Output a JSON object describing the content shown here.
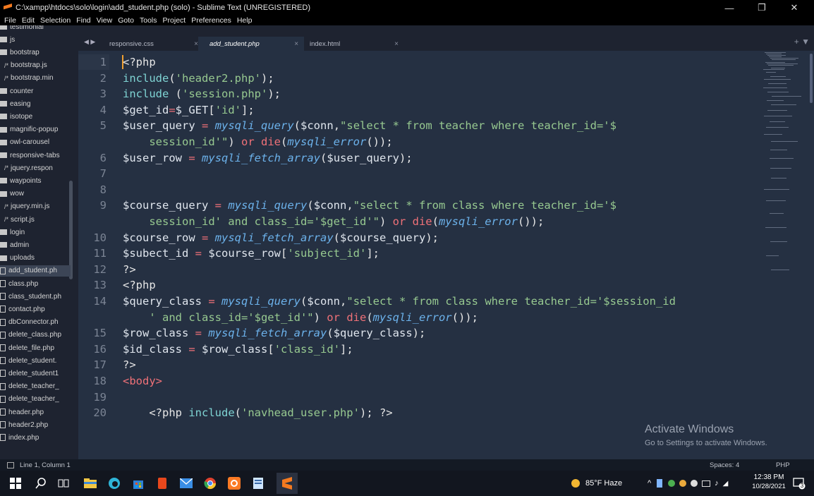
{
  "window": {
    "title": "C:\\xampp\\htdocs\\solo\\login\\add_student.php (solo) - Sublime Text (UNREGISTERED)",
    "minimize": "—",
    "maximize": "❐",
    "close": "✕"
  },
  "menu": [
    "File",
    "Edit",
    "Selection",
    "Find",
    "View",
    "Goto",
    "Tools",
    "Project",
    "Preferences",
    "Help"
  ],
  "sidebar": {
    "items": [
      {
        "label": "testimonial",
        "type": "folder"
      },
      {
        "label": "js",
        "type": "folder-open"
      },
      {
        "label": "bootstrap",
        "type": "folder-open"
      },
      {
        "label": "bootstrap.js",
        "type": "js"
      },
      {
        "label": "bootstrap.min",
        "type": "js"
      },
      {
        "label": "counter",
        "type": "folder"
      },
      {
        "label": "easing",
        "type": "folder"
      },
      {
        "label": "isotope",
        "type": "folder"
      },
      {
        "label": "magnific-popup",
        "type": "folder"
      },
      {
        "label": "owl-carousel",
        "type": "folder"
      },
      {
        "label": "responsive-tabs",
        "type": "folder"
      },
      {
        "label": "jquery.respon",
        "type": "js"
      },
      {
        "label": "waypoints",
        "type": "folder"
      },
      {
        "label": "wow",
        "type": "folder"
      },
      {
        "label": "jquery.min.js",
        "type": "js"
      },
      {
        "label": "script.js",
        "type": "js"
      },
      {
        "label": "login",
        "type": "folder-open"
      },
      {
        "label": "admin",
        "type": "folder"
      },
      {
        "label": "uploads",
        "type": "folder"
      },
      {
        "label": "add_student.ph",
        "type": "file",
        "active": true
      },
      {
        "label": "class.php",
        "type": "file"
      },
      {
        "label": "class_student.ph",
        "type": "file"
      },
      {
        "label": "contact.php",
        "type": "file"
      },
      {
        "label": "dbConnector.ph",
        "type": "file"
      },
      {
        "label": "delete_class.php",
        "type": "file"
      },
      {
        "label": "delete_file.php",
        "type": "file"
      },
      {
        "label": "delete_student.",
        "type": "file"
      },
      {
        "label": "delete_student1",
        "type": "file"
      },
      {
        "label": "delete_teacher_",
        "type": "file"
      },
      {
        "label": "delete_teacher_",
        "type": "file"
      },
      {
        "label": "header.php",
        "type": "file"
      },
      {
        "label": "header2.php",
        "type": "file"
      },
      {
        "label": "index.php",
        "type": "file"
      }
    ]
  },
  "tabs": [
    {
      "label": "responsive.css",
      "close": "×"
    },
    {
      "label": "add_student.php",
      "close": "×",
      "active": true
    },
    {
      "label": "index.html",
      "close": "×"
    }
  ],
  "tab_controls": {
    "arrows": "◀ ▶",
    "plus": "+ ▼"
  },
  "editor": {
    "line_numbers": [
      "1",
      "2",
      "3",
      "4",
      "5",
      "",
      "6",
      "7",
      "8",
      "9",
      "",
      "10",
      "11",
      "12",
      "13",
      "14",
      "",
      "15",
      "16",
      "17",
      "18",
      "19",
      "20"
    ],
    "lines": [
      [
        [
          "plain",
          "<?php"
        ]
      ],
      [
        [
          "kw",
          "include"
        ],
        [
          "plain",
          "("
        ],
        [
          "str",
          "'header2.php'"
        ],
        [
          "plain",
          ");"
        ]
      ],
      [
        [
          "kw",
          "include"
        ],
        [
          "plain",
          " ("
        ],
        [
          "str",
          "'session.php'"
        ],
        [
          "plain",
          ");"
        ]
      ],
      [
        [
          "var",
          "$get_id"
        ],
        [
          "op",
          "="
        ],
        [
          "var",
          "$_GET"
        ],
        [
          "plain",
          "["
        ],
        [
          "str",
          "'id'"
        ],
        [
          "plain",
          "];"
        ]
      ],
      [
        [
          "var",
          "$user_query"
        ],
        [
          "plain",
          " "
        ],
        [
          "op",
          "="
        ],
        [
          "plain",
          " "
        ],
        [
          "fn",
          "mysqli_query"
        ],
        [
          "plain",
          "("
        ],
        [
          "var",
          "$conn"
        ],
        [
          "plain",
          ","
        ],
        [
          "str",
          "\"select * from teacher where teacher_id='$"
        ]
      ],
      [
        [
          "str",
          "    session_id'\""
        ],
        [
          "plain",
          ") "
        ],
        [
          "op",
          "or"
        ],
        [
          "plain",
          " "
        ],
        [
          "op",
          "die"
        ],
        [
          "plain",
          "("
        ],
        [
          "fn",
          "mysqli_error"
        ],
        [
          "plain",
          "());"
        ]
      ],
      [
        [
          "var",
          "$user_row"
        ],
        [
          "plain",
          " "
        ],
        [
          "op",
          "="
        ],
        [
          "plain",
          " "
        ],
        [
          "fn",
          "mysqli_fetch_array"
        ],
        [
          "plain",
          "("
        ],
        [
          "var",
          "$user_query"
        ],
        [
          "plain",
          ");"
        ]
      ],
      [],
      [],
      [
        [
          "var",
          "$course_query"
        ],
        [
          "plain",
          " "
        ],
        [
          "op",
          "="
        ],
        [
          "plain",
          " "
        ],
        [
          "fn",
          "mysqli_query"
        ],
        [
          "plain",
          "("
        ],
        [
          "var",
          "$conn"
        ],
        [
          "plain",
          ","
        ],
        [
          "str",
          "\"select * from class where teacher_id='$"
        ]
      ],
      [
        [
          "str",
          "    session_id' and class_id='$get_id'\""
        ],
        [
          "plain",
          ") "
        ],
        [
          "op",
          "or"
        ],
        [
          "plain",
          " "
        ],
        [
          "op",
          "die"
        ],
        [
          "plain",
          "("
        ],
        [
          "fn",
          "mysqli_error"
        ],
        [
          "plain",
          "());"
        ]
      ],
      [
        [
          "var",
          "$course_row"
        ],
        [
          "plain",
          " "
        ],
        [
          "op",
          "="
        ],
        [
          "plain",
          " "
        ],
        [
          "fn",
          "mysqli_fetch_array"
        ],
        [
          "plain",
          "("
        ],
        [
          "var",
          "$course_query"
        ],
        [
          "plain",
          ");"
        ]
      ],
      [
        [
          "var",
          "$subect_id"
        ],
        [
          "plain",
          " "
        ],
        [
          "op",
          "="
        ],
        [
          "plain",
          " "
        ],
        [
          "var",
          "$course_row"
        ],
        [
          "plain",
          "["
        ],
        [
          "str",
          "'subject_id'"
        ],
        [
          "plain",
          "];"
        ]
      ],
      [
        [
          "plain",
          "?>"
        ]
      ],
      [
        [
          "plain",
          "<?php"
        ]
      ],
      [
        [
          "var",
          "$query_class"
        ],
        [
          "plain",
          " "
        ],
        [
          "op",
          "="
        ],
        [
          "plain",
          " "
        ],
        [
          "fn",
          "mysqli_query"
        ],
        [
          "plain",
          "("
        ],
        [
          "var",
          "$conn"
        ],
        [
          "plain",
          ","
        ],
        [
          "str",
          "\"select * from class where teacher_id='$session_id"
        ]
      ],
      [
        [
          "str",
          "    ' and class_id='$get_id'\""
        ],
        [
          "plain",
          ") "
        ],
        [
          "op",
          "or"
        ],
        [
          "plain",
          " "
        ],
        [
          "op",
          "die"
        ],
        [
          "plain",
          "("
        ],
        [
          "fn",
          "mysqli_error"
        ],
        [
          "plain",
          "());"
        ]
      ],
      [
        [
          "var",
          "$row_class"
        ],
        [
          "plain",
          " "
        ],
        [
          "op",
          "="
        ],
        [
          "plain",
          " "
        ],
        [
          "fn",
          "mysqli_fetch_array"
        ],
        [
          "plain",
          "("
        ],
        [
          "var",
          "$query_class"
        ],
        [
          "plain",
          ");"
        ]
      ],
      [
        [
          "var",
          "$id_class"
        ],
        [
          "plain",
          " "
        ],
        [
          "op",
          "="
        ],
        [
          "plain",
          " "
        ],
        [
          "var",
          "$row_class"
        ],
        [
          "plain",
          "["
        ],
        [
          "str",
          "'class_id'"
        ],
        [
          "plain",
          "];"
        ]
      ],
      [
        [
          "plain",
          "?>"
        ]
      ],
      [
        [
          "tag",
          "<body>"
        ]
      ],
      [],
      [
        [
          "plain",
          "    <?php "
        ],
        [
          "kw",
          "include"
        ],
        [
          "plain",
          "("
        ],
        [
          "str",
          "'navhead_user.php'"
        ],
        [
          "plain",
          "); ?>"
        ]
      ]
    ]
  },
  "watermark": {
    "title": "Activate Windows",
    "subtitle": "Go to Settings to activate Windows."
  },
  "status": {
    "position": "Line 1, Column 1",
    "spaces": "Spaces: 4",
    "syntax": "PHP"
  },
  "taskbar": {
    "weather": "85°F  Haze",
    "time": "12:38 PM",
    "date": "10/28/2021",
    "notification_count": "3"
  }
}
